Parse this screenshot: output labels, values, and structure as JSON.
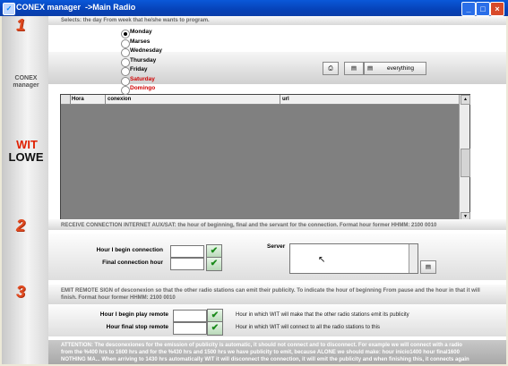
{
  "window": {
    "title": "CONEX manager  ->Main Radio",
    "minimize": "_",
    "maximize": "□",
    "close": "×"
  },
  "sidebar": {
    "steps": [
      "1",
      "2",
      "3"
    ],
    "brand_line1": "CONEX",
    "brand_line2": "manager",
    "wit": "WIT",
    "lowe": "LOWE"
  },
  "section1": {
    "instruction": "Selects: the day From week that he/she wants to program.",
    "days": [
      {
        "label": "Monday",
        "selected": true,
        "color": "#000000"
      },
      {
        "label": "Marses",
        "selected": false,
        "color": "#000000"
      },
      {
        "label": "Wednesday",
        "selected": false,
        "color": "#000000"
      },
      {
        "label": "Thursday",
        "selected": false,
        "color": "#000000"
      },
      {
        "label": "Friday",
        "selected": false,
        "color": "#000000"
      },
      {
        "label": "Saturday",
        "selected": false,
        "color": "#d00000"
      },
      {
        "label": "Domingo",
        "selected": false,
        "color": "#d00000"
      }
    ],
    "toolbar": {
      "print_icon": "printer-icon",
      "grid1_icon": "grid-icon",
      "grid2_icon": "grid-icon",
      "everything_label": "everything"
    },
    "table": {
      "columns": [
        "Hora",
        "conexion",
        "url"
      ]
    }
  },
  "section2": {
    "instruction": "RECEIVE CONNECTION INTERNET AUX/SAT: the hour of beginning, final and the servant for the connection.  Format hour former HHMM: 2100 0010",
    "begin_label": "Hour I begin connection",
    "final_label": "Final connection hour",
    "server_label": "Server",
    "begin_value": "",
    "final_value": "",
    "server_value": ""
  },
  "section3": {
    "instruction_line1": "EMIT REMOTE SIGN of desconexion so that the other radio stations can emit their publicity. To indicate the hour of beginning From pause and the hour in that it will",
    "instruction_line2": "finish. Format hour former HHMM: 2100 0010",
    "begin_label": "Hour I begin play remote",
    "stop_label": "Hour final stop remote",
    "begin_desc": "Hour in which WIT will make that the other radio stations emit its publicity",
    "stop_desc": "Hour in which WIT will connect to all the radio stations to this",
    "begin_value": "",
    "stop_value": ""
  },
  "attention": {
    "line1": "ATTENTION: The desconexiones for the emission of publicity is automatic, it should not connect and to disconnect. For example we will connect with a radio",
    "line2": "from the %400 hrs to 1600 hrs and for the %430 hrs and 1500 hrs we have publicity to emit, because ALONE we should make:   hour inicio1400 hour final1600",
    "line3": "NOTHING MA...  When arriving to 1430 hrs automatically WIT it will disconnect the connection, it will emit the publicity and when finishing this, it connects again"
  }
}
